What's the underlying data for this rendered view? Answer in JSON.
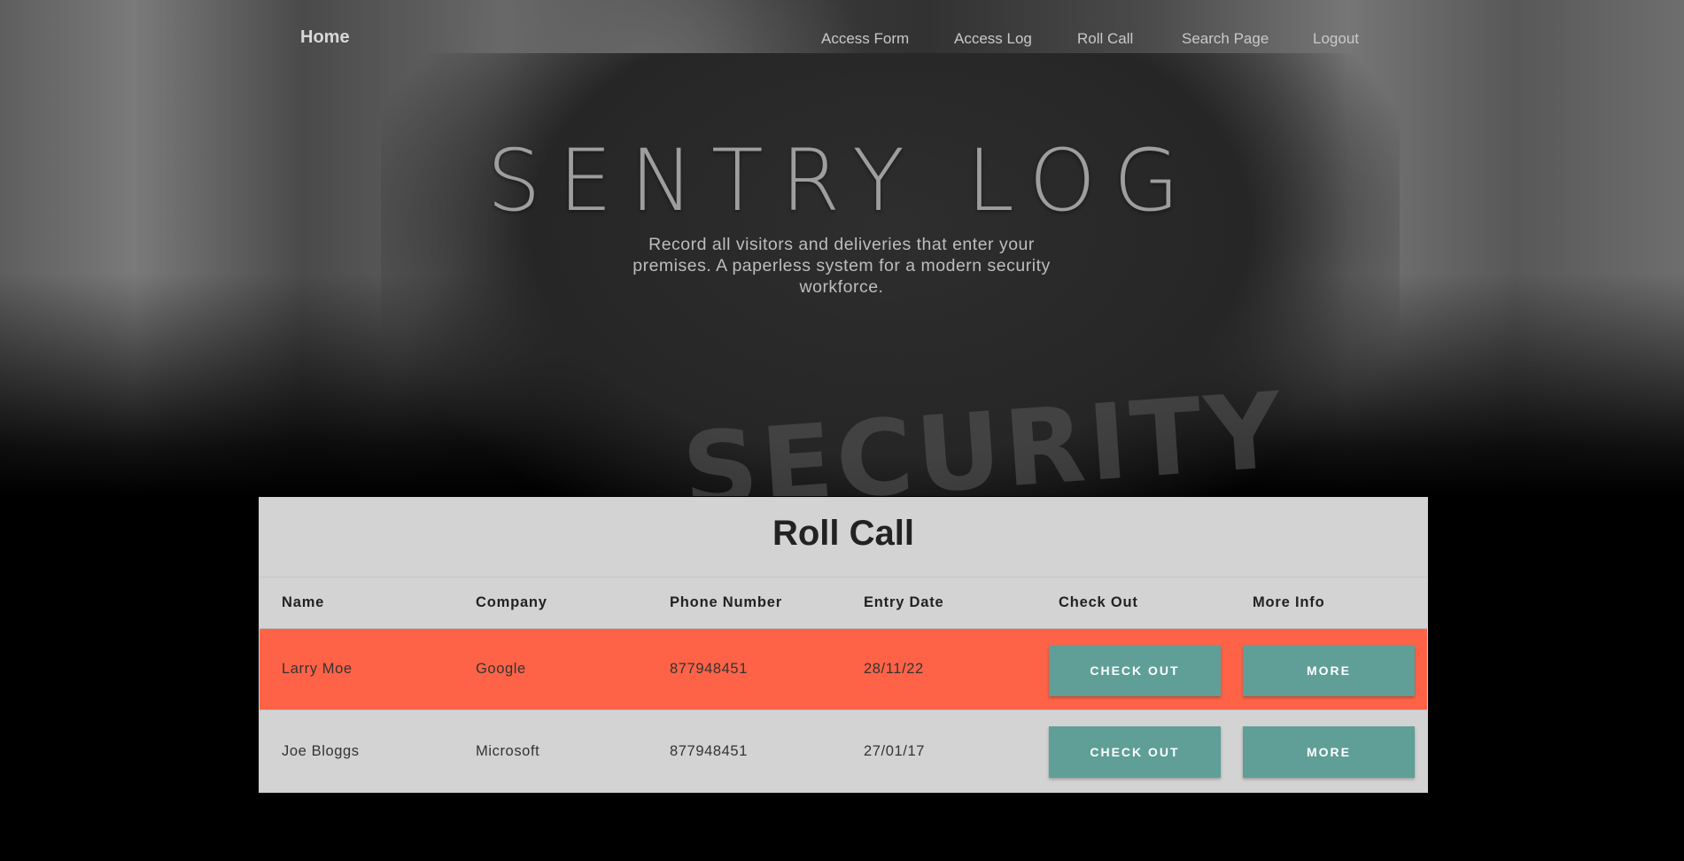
{
  "nav": {
    "home": "Home",
    "links": [
      "Access Form",
      "Access Log",
      "Roll Call",
      "Search Page",
      "Logout"
    ]
  },
  "hero": {
    "title": "SENTRY LOG",
    "subtitle": "Record all visitors and deliveries that enter your premises. A paperless system for a modern security workforce.",
    "background_print": "SECURITY"
  },
  "roll_call": {
    "title": "Roll Call",
    "columns": [
      "Name",
      "Company",
      "Phone Number",
      "Entry Date",
      "Check Out",
      "More Info"
    ],
    "rows": [
      {
        "name": "Larry Moe",
        "company": "Google",
        "phone": "877948451",
        "entry_date": "28/11/22",
        "check_out_label": "CHECK OUT",
        "more_label": "MORE",
        "highlighted": true
      },
      {
        "name": "Joe Bloggs",
        "company": "Microsoft",
        "phone": "877948451",
        "entry_date": "27/01/17",
        "check_out_label": "CHECK OUT",
        "more_label": "MORE",
        "highlighted": false
      }
    ]
  },
  "colors": {
    "highlight_row": "#ff6347",
    "button": "#5f9f98",
    "panel": "#d3d3d3"
  }
}
